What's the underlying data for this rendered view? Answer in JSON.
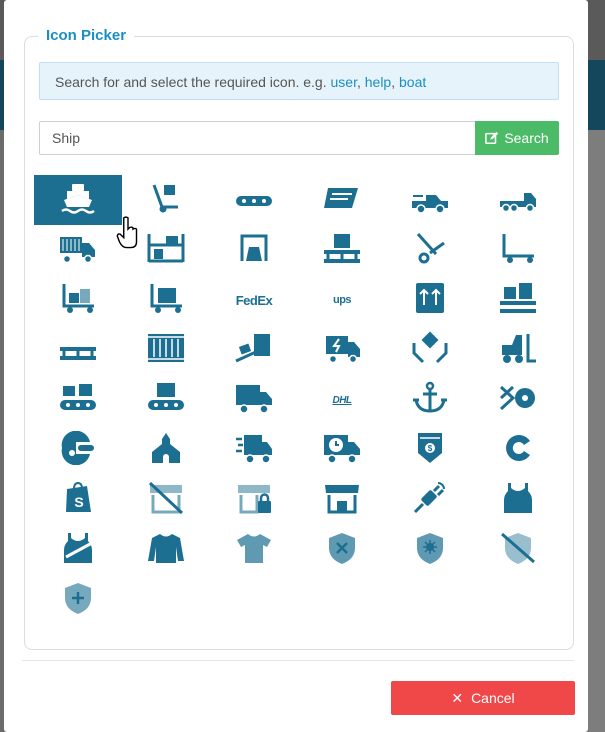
{
  "dialog": {
    "title": "Icon Picker",
    "hint_prefix": "Search for and select the required icon. e.g. ",
    "hint_examples": [
      "user",
      "help",
      "boat"
    ],
    "hint_separator": ", "
  },
  "search": {
    "value": "Ship",
    "button_label": "Search"
  },
  "icons": [
    {
      "name": "ship-icon",
      "selected": true
    },
    {
      "name": "dolly-icon"
    },
    {
      "name": "conveyor-belt-icon"
    },
    {
      "name": "usps-icon"
    },
    {
      "name": "truck-pickup-icon"
    },
    {
      "name": "flatbed-truck-icon"
    },
    {
      "name": "container-truck-icon"
    },
    {
      "name": "pallet-rack-icon"
    },
    {
      "name": "loading-dock-icon"
    },
    {
      "name": "pallet-box-icon"
    },
    {
      "name": "hand-truck-icon"
    },
    {
      "name": "dolly-flatbed-icon"
    },
    {
      "name": "dolly-flatbed-alt-icon"
    },
    {
      "name": "dolly-box-icon"
    },
    {
      "name": "fedex-icon",
      "text": "FedEx"
    },
    {
      "name": "ups-icon",
      "text": "ups"
    },
    {
      "name": "this-side-up-icon"
    },
    {
      "name": "pallet-boxes-icon"
    },
    {
      "name": "pallet-icon"
    },
    {
      "name": "container-storage-icon"
    },
    {
      "name": "truck-ramp-icon"
    },
    {
      "name": "shipping-fast-icon"
    },
    {
      "name": "hands-holding-box-icon"
    },
    {
      "name": "forklift-icon"
    },
    {
      "name": "conveyor-boxes-icon"
    },
    {
      "name": "conveyor-box-icon"
    },
    {
      "name": "truck-icon"
    },
    {
      "name": "dhl-icon",
      "text": "DHL"
    },
    {
      "name": "anchor-icon"
    },
    {
      "name": "shippable-icon"
    },
    {
      "name": "shipping-help-icon"
    },
    {
      "name": "church-icon"
    },
    {
      "name": "truck-fast-icon"
    },
    {
      "name": "truck-clock-icon"
    },
    {
      "name": "shipping-badge-icon"
    },
    {
      "name": "cloudflare-like-icon"
    },
    {
      "name": "shopify-icon"
    },
    {
      "name": "store-slash-icon"
    },
    {
      "name": "store-lock-icon"
    },
    {
      "name": "store-icon"
    },
    {
      "name": "plug-icon"
    },
    {
      "name": "tank-top-icon"
    },
    {
      "name": "tank-top-sash-icon"
    },
    {
      "name": "long-sleeve-shirt-icon"
    },
    {
      "name": "t-shirt-icon"
    },
    {
      "name": "shield-xmark-icon"
    },
    {
      "name": "shield-virus-icon"
    },
    {
      "name": "shield-slash-icon"
    },
    {
      "name": "shield-plus-icon"
    }
  ],
  "footer": {
    "cancel_label": "Cancel"
  },
  "colors": {
    "accent": "#1d6f92",
    "title": "#1a8fc2",
    "search_button": "#4cbb68",
    "cancel_button": "#f04848"
  }
}
